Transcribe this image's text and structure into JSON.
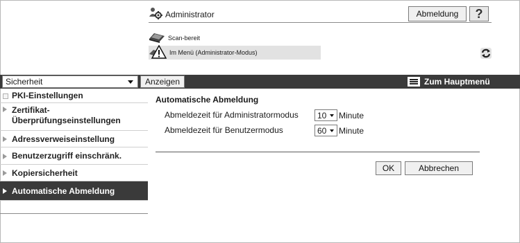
{
  "header": {
    "user_label": "Administrator",
    "logout_label": "Abmeldung",
    "help_label": "?"
  },
  "status": {
    "line1": "Scan-bereit",
    "line2": "Im Menü (Administrator-Modus)"
  },
  "toolbar": {
    "select_value": "Sicherheit",
    "show_label": "Anzeigen",
    "main_menu_label": "Zum Hauptmenü"
  },
  "sidebar": {
    "items": [
      {
        "label": "PKI-Einstellungen",
        "lines": [
          "PKI-Einstellungen"
        ],
        "style": "box"
      },
      {
        "label": "Zertifikat-Überprüfungseinstellungen",
        "lines": [
          "Zertifikat-",
          "Überprüfungseinstellungen"
        ],
        "style": "arrow"
      },
      {
        "label": "Adressverweiseinstellung",
        "lines": [
          "Adressverweiseinstellung"
        ],
        "style": "arrow"
      },
      {
        "label": "Benutzerzugriff einschränk.",
        "lines": [
          "Benutzerzugriff einschränk."
        ],
        "style": "arrow"
      },
      {
        "label": "Kopiersicherheit",
        "lines": [
          "Kopiersicherheit"
        ],
        "style": "arrow"
      },
      {
        "label": "Automatische Abmeldung",
        "lines": [
          "Automatische Abmeldung"
        ],
        "style": "arrow",
        "active": true
      }
    ]
  },
  "content": {
    "title": "Automatische Abmeldung",
    "rows": [
      {
        "label": "Abmeldezeit für Administratormodus",
        "value": "10",
        "unit": "Minute"
      },
      {
        "label": "Abmeldezeit für Benutzermodus",
        "value": "60",
        "unit": "Minute"
      }
    ],
    "ok_label": "OK",
    "cancel_label": "Abbrechen"
  }
}
